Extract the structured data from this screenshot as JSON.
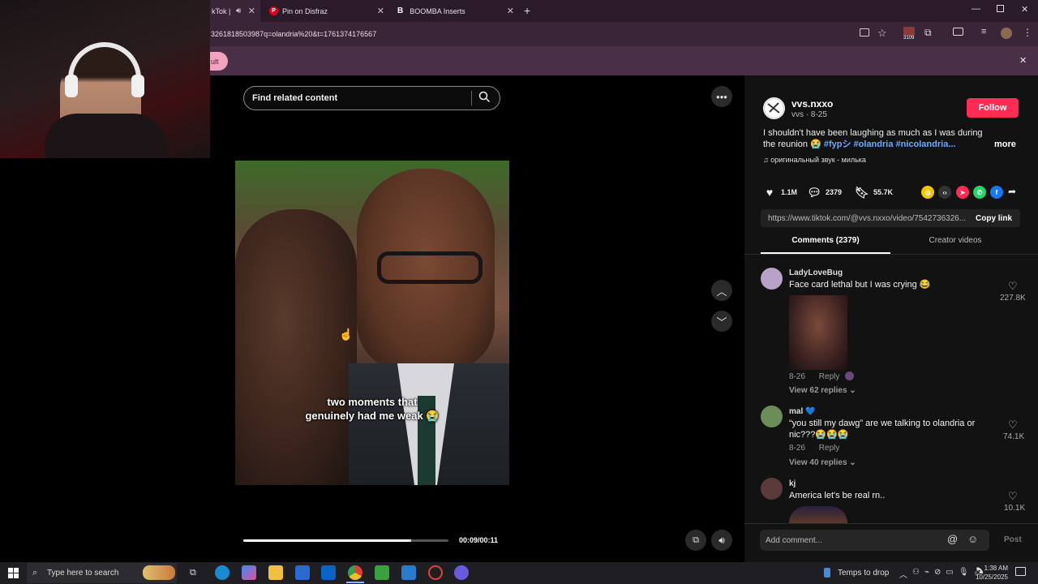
{
  "browser": {
    "tabs": [
      {
        "label": "kTok |",
        "active": true
      },
      {
        "label": "Pin on Disfraz",
        "icon": "pinterest-icon",
        "active": false
      },
      {
        "label": "BOOMBA Inserts",
        "icon": "b-icon",
        "active": false
      }
    ],
    "url": "3261818503987q=olandria%20&t=1761374176567",
    "infobar_pill": "ult",
    "toolbar_badge": "3109"
  },
  "video": {
    "search_placeholder": "Find related content",
    "caption_line1": "two moments that",
    "caption_line2": "genuinely had me weak 😭",
    "time": "00:09/00:11",
    "progress": 0.82
  },
  "post": {
    "author": "vvs.nxxo",
    "author_sub": "vvs · 8-25",
    "follow_label": "Follow",
    "desc_text": "I shouldn't have been laughing as much as I was during the reunion 😭 ",
    "tags": [
      "#fypシ",
      "#olandria",
      "#nicolandria..."
    ],
    "more_label": "more",
    "sound": "♫  оригинальный звук - милька",
    "likes": "1.1M",
    "comments_count": "2379",
    "saves": "55.7K",
    "link": "https://www.tiktok.com/@vvs.nxxo/video/7542736326...",
    "copy_label": "Copy link",
    "tab_comments": "Comments (2379)",
    "tab_creator": "Creator videos"
  },
  "comments": [
    {
      "user": "LadyLoveBug",
      "text": "Face card lethal but I was crying 😂",
      "date": "8-26",
      "reply": "Reply",
      "replies": "View 62 replies ⌄",
      "likes": "227.8K",
      "avatar_color": "#b9a2c9"
    },
    {
      "user": "mal 💙",
      "text": "“you still my dawg” are we talking to olandria or nic???😭😭😭",
      "date": "8-26",
      "reply": "Reply",
      "replies": "View 40 replies ⌄",
      "likes": "74.1K",
      "avatar_color": "#6c8c5a"
    },
    {
      "user": "kj",
      "text": "America let's be real rn..",
      "likes": "10.1K",
      "avatar_color": "#5a3a3a"
    }
  ],
  "comment_bar": {
    "placeholder": "Add comment...",
    "post_label": "Post"
  },
  "taskbar": {
    "search_placeholder": "Type here to search",
    "weather": "Temps to drop",
    "time": "1:38 AM",
    "date": "10/25/2025"
  },
  "colors": {
    "accent": "#fe2c55",
    "tag": "#6fa8ff",
    "browser": "#3a2538"
  }
}
